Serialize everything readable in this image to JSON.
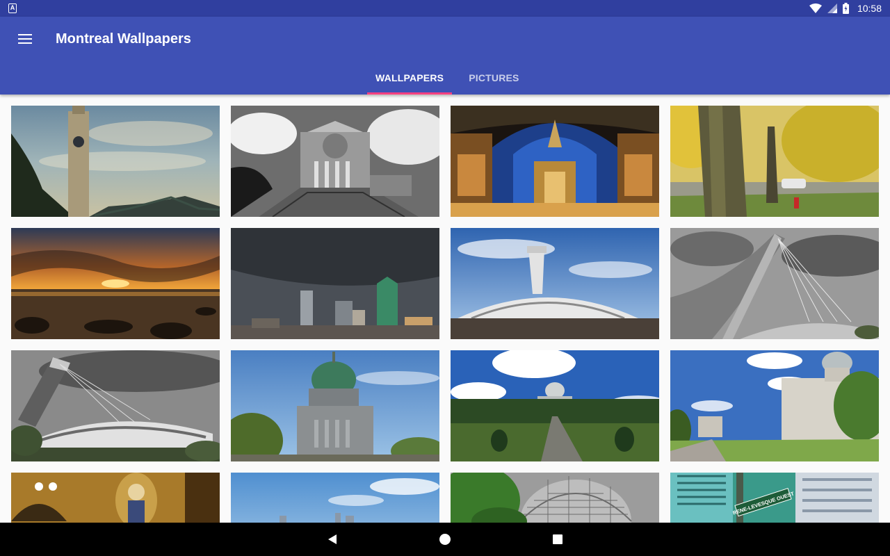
{
  "status_bar": {
    "app_icon": "A",
    "time": "10:58",
    "icons": [
      "wifi-icon",
      "signal-icon",
      "battery-icon"
    ]
  },
  "app_bar": {
    "title": "Montreal Wallpapers",
    "menu_icon": "hamburger-menu-icon"
  },
  "tabs": [
    {
      "label": "WALLPAPERS",
      "active": true
    },
    {
      "label": "PICTURES",
      "active": false
    }
  ],
  "colors": {
    "status_bar": "#303f9f",
    "primary": "#3f51b5",
    "tab_indicator": "#ff4081",
    "background": "#fafafa"
  },
  "wallpapers": [
    {
      "subject": "clock tower and bridge"
    },
    {
      "subject": "oratory black and white"
    },
    {
      "subject": "basilica interior"
    },
    {
      "subject": "autumn tree"
    },
    {
      "subject": "sunset over river"
    },
    {
      "subject": "storm over skyline"
    },
    {
      "subject": "olympic stadium"
    },
    {
      "subject": "olympic tower cables"
    },
    {
      "subject": "olympic stadium grey"
    },
    {
      "subject": "oratory green dome"
    },
    {
      "subject": "oratory park path"
    },
    {
      "subject": "city hall building"
    },
    {
      "subject": "mosaic interior"
    },
    {
      "subject": "skyline sky"
    },
    {
      "subject": "biosphere dome"
    },
    {
      "subject": "rene-levesque street sign"
    }
  ],
  "street_sign": "RENE-LEVESQUE OUEST",
  "nav_bar": {
    "icons": [
      "back-icon",
      "home-icon",
      "recents-icon"
    ]
  }
}
